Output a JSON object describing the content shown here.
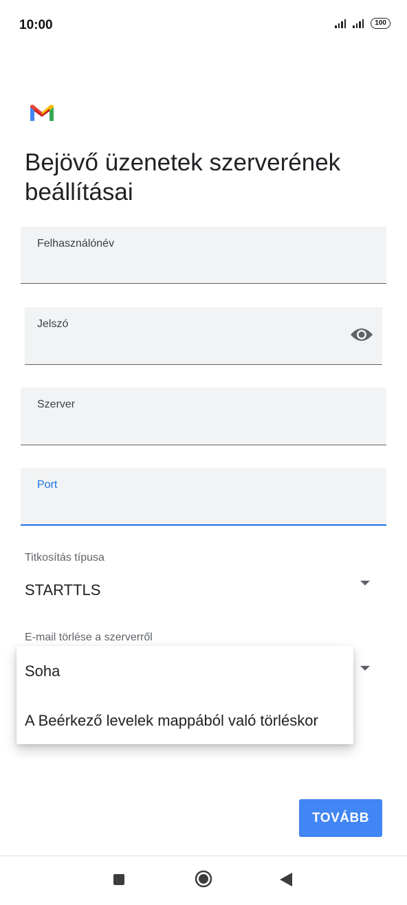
{
  "status_bar": {
    "time": "10:00",
    "battery": "100",
    "icons": [
      "signal-icon",
      "signal-icon",
      "battery-icon"
    ]
  },
  "app": {
    "logo_icon": "gmail-logo-icon",
    "title": "Bejövő üzenetek szerverének beállításai"
  },
  "fields": {
    "username": {
      "label": "Felhasználónév",
      "value": ""
    },
    "password": {
      "label": "Jelszó",
      "value": "",
      "toggle_icon": "eye-icon"
    },
    "server": {
      "label": "Szerver",
      "value": ""
    },
    "port": {
      "label": "Port",
      "value": ""
    }
  },
  "encryption": {
    "label": "Titkosítás típusa",
    "value": "STARTTLS"
  },
  "delete_from_server": {
    "label": "E-mail törlése a szerverről",
    "options": [
      "Soha",
      "A Beérkező levelek mappából való törléskor"
    ]
  },
  "actions": {
    "next_label": "TOVÁBB"
  },
  "colors": {
    "accent": "#1a73e8",
    "button": "#4285f4",
    "field_bg": "#f1f3f4"
  },
  "nav": {
    "icons": [
      "recents-square-icon",
      "home-circle-icon",
      "back-triangle-icon"
    ]
  }
}
